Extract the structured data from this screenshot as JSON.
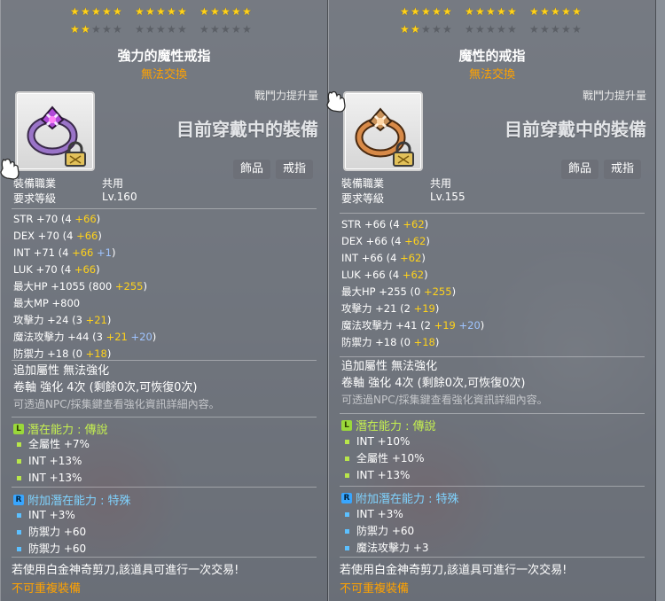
{
  "left": {
    "stars_row1": 15,
    "stars_row2_filled": 2,
    "name": "強力的魔性戒指",
    "trade": "無法交換",
    "power_up": "戰鬥力提升量",
    "worn": "目前穿戴中的裝備",
    "tags": [
      "飾品",
      "戒指"
    ],
    "req": [
      {
        "k": "裝備職業",
        "v": "共用"
      },
      {
        "k": "要求等級",
        "v": "Lv.160"
      }
    ],
    "stats": [
      {
        "name": "STR",
        "base": "+70",
        "open": " (4 ",
        "y": "+66",
        "b": "",
        "close": ")"
      },
      {
        "name": "DEX",
        "base": "+70",
        "open": " (4 ",
        "y": "+66",
        "b": "",
        "close": ")"
      },
      {
        "name": "INT",
        "base": "+71",
        "open": " (4 ",
        "y": "+66",
        "b": " +1",
        "close": ")"
      },
      {
        "name": "LUK",
        "base": "+70",
        "open": " (4 ",
        "y": "+66",
        "b": "",
        "close": ")"
      },
      {
        "name": "最大HP",
        "base": "+1055",
        "open": " (800 ",
        "y": "+255",
        "b": "",
        "close": ")"
      },
      {
        "name": "最大MP",
        "base": "+800",
        "open": "",
        "y": "",
        "b": "",
        "close": ""
      },
      {
        "name": "攻擊力",
        "base": "+24",
        "open": " (3 ",
        "y": "+21",
        "b": "",
        "close": ")"
      },
      {
        "name": "魔法攻擊力",
        "base": "+44",
        "open": " (3 ",
        "y": "+21",
        "b": " +20",
        "close": ")"
      },
      {
        "name": "防禦力",
        "base": "+18",
        "open": " (0 ",
        "y": "+18",
        "b": "",
        "close": ")"
      }
    ],
    "extra": "追加屬性 無法強化",
    "scroll": "卷軸 強化 4次 (剩餘0次,可恢復0次)",
    "hint": "可透過NPC/採集鍵查看強化資訊詳細內容。",
    "pot_title_prefix": "潛在能力 : ",
    "pot_grade": "傳說",
    "pot": [
      "全屬性 +7%",
      "INT +13%",
      "INT +13%"
    ],
    "add_title_prefix": "附加潛在能力 : ",
    "add_grade": "特殊",
    "add": [
      "INT +3%",
      "防禦力 +60",
      "防禦力 +60"
    ],
    "footer1": "若使用白金神奇剪刀,該道具可進行一次交易!",
    "footer2": "不可重複裝備"
  },
  "right": {
    "stars_row1": 15,
    "stars_row2_filled": 2,
    "name": "魔性的戒指",
    "trade": "無法交換",
    "power_up": "戰鬥力提升量",
    "worn": "目前穿戴中的裝備",
    "tags": [
      "飾品",
      "戒指"
    ],
    "req": [
      {
        "k": "裝備職業",
        "v": "共用"
      },
      {
        "k": "要求等級",
        "v": "Lv.155"
      }
    ],
    "stats": [
      {
        "name": "STR",
        "base": "+66",
        "open": " (4 ",
        "y": "+62",
        "b": "",
        "close": ")"
      },
      {
        "name": "DEX",
        "base": "+66",
        "open": " (4 ",
        "y": "+62",
        "b": "",
        "close": ")"
      },
      {
        "name": "INT",
        "base": "+66",
        "open": " (4 ",
        "y": "+62",
        "b": "",
        "close": ")"
      },
      {
        "name": "LUK",
        "base": "+66",
        "open": " (4 ",
        "y": "+62",
        "b": "",
        "close": ")"
      },
      {
        "name": "最大HP",
        "base": "+255",
        "open": " (0 ",
        "y": "+255",
        "b": "",
        "close": ")"
      },
      {
        "name": "攻擊力",
        "base": "+21",
        "open": " (2 ",
        "y": "+19",
        "b": "",
        "close": ")"
      },
      {
        "name": "魔法攻擊力",
        "base": "+41",
        "open": " (2 ",
        "y": "+19",
        "b": " +20",
        "close": ")"
      },
      {
        "name": "防禦力",
        "base": "+18",
        "open": " (0 ",
        "y": "+18",
        "b": "",
        "close": ")"
      }
    ],
    "extra": "追加屬性 無法強化",
    "scroll": "卷軸 強化 4次 (剩餘0次,可恢復0次)",
    "hint": "可透過NPC/採集鍵查看強化資訊詳細內容。",
    "pot_title_prefix": "潛在能力 : ",
    "pot_grade": "傳說",
    "pot": [
      "INT +10%",
      "全屬性 +10%",
      "INT +13%"
    ],
    "add_title_prefix": "附加潛在能力 : ",
    "add_grade": "特殊",
    "add": [
      "INT +3%",
      "防禦力 +60",
      "魔法攻擊力 +3"
    ],
    "footer1": "若使用白金神奇剪刀,該道具可進行一次交易!",
    "footer2": "不可重複裝備"
  },
  "badges": {
    "legendary": "L",
    "rare": "R"
  },
  "colors": {
    "gold": "#ffd21a",
    "orange": "#ffa200",
    "legend_green": "#c5f050",
    "special_blue": "#7fd3ff"
  },
  "icons": {
    "left_item": "purple-ring-icon",
    "right_item": "bronze-ring-icon",
    "lock": "lock-icon",
    "cursor": "glove-cursor-icon"
  }
}
